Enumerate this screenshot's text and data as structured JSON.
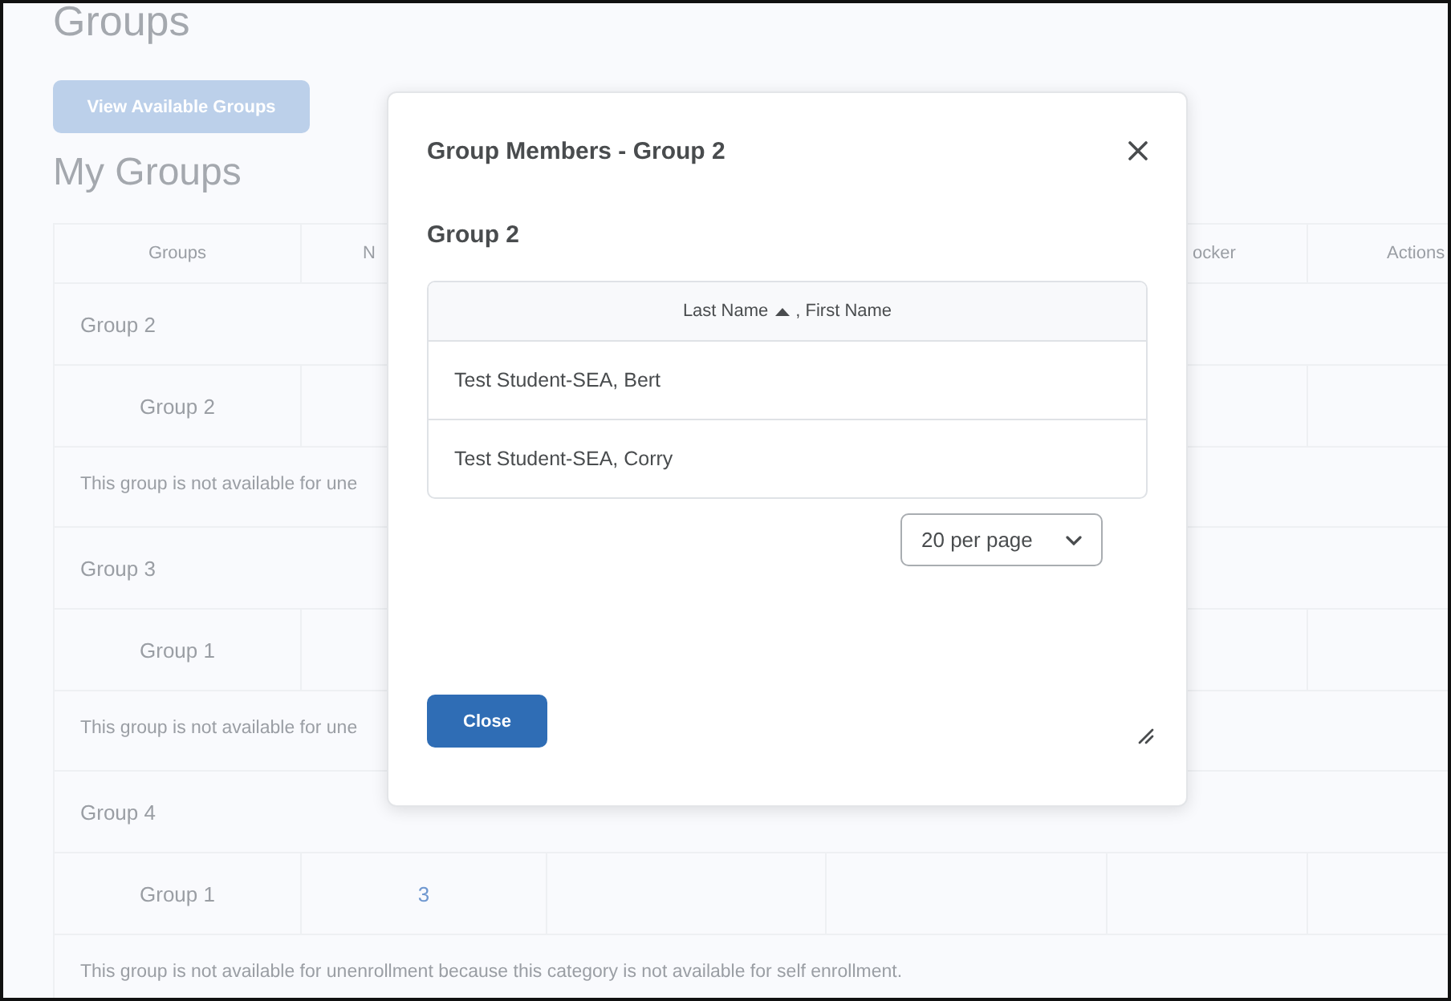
{
  "page": {
    "title": "Groups",
    "view_button": "View Available Groups",
    "heading": "My Groups",
    "columns": [
      {
        "label": "Groups"
      },
      {
        "label": "N"
      },
      {},
      {},
      {
        "label": "ocker"
      },
      {
        "label": "Actions"
      }
    ],
    "sections": [
      {
        "category": "Group 2",
        "groups": [
          {
            "name": "Group 2"
          }
        ],
        "message": "This group is not available for une"
      },
      {
        "category": "Group 3",
        "groups": [
          {
            "name": "Group 1"
          }
        ],
        "message": "This group is not available for une"
      },
      {
        "category": "Group 4",
        "groups": [
          {
            "name": "Group 1",
            "members": "3"
          }
        ],
        "message": "This group is not available for unenrollment because this category is not available for self enrollment."
      }
    ]
  },
  "dialog": {
    "title": "Group Members - Group 2",
    "group_name": "Group 2",
    "column": {
      "sorted_label": "Last Name",
      "ascending": true,
      "rest_label": ", First Name"
    },
    "rows": [
      "Test Student-SEA, Bert",
      "Test Student-SEA, Corry"
    ],
    "page_size": "20 per page",
    "close_button": "Close"
  }
}
